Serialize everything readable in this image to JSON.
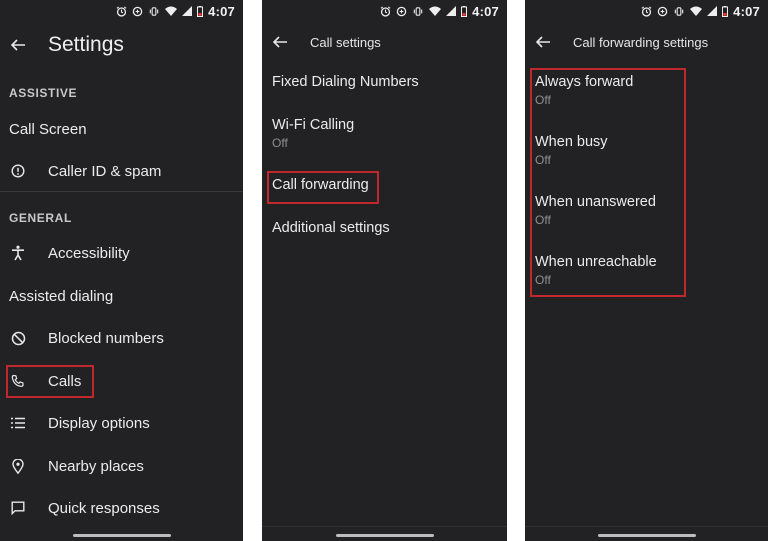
{
  "status": {
    "time": "4:07"
  },
  "panel1": {
    "title": "Settings",
    "assistive_header": "ASSISTIVE",
    "call_screen": "Call Screen",
    "caller_id": "Caller ID & spam",
    "general_header": "GENERAL",
    "accessibility": "Accessibility",
    "assisted_dialing": "Assisted dialing",
    "blocked_numbers": "Blocked numbers",
    "calls": "Calls",
    "display_options": "Display options",
    "nearby_places": "Nearby places",
    "quick_responses": "Quick responses"
  },
  "panel2": {
    "title": "Call settings",
    "items": [
      {
        "label": "Fixed Dialing Numbers",
        "sub": ""
      },
      {
        "label": "Wi-Fi Calling",
        "sub": "Off"
      },
      {
        "label": "Call forwarding",
        "sub": ""
      },
      {
        "label": "Additional settings",
        "sub": ""
      }
    ]
  },
  "panel3": {
    "title": "Call forwarding settings",
    "items": [
      {
        "label": "Always forward",
        "sub": "Off"
      },
      {
        "label": "When busy",
        "sub": "Off"
      },
      {
        "label": "When unanswered",
        "sub": "Off"
      },
      {
        "label": "When unreachable",
        "sub": "Off"
      }
    ]
  },
  "colors": {
    "background": "#222224",
    "highlight": "#c0282d",
    "text": "#ececec",
    "subtext": "#8f8f8f"
  },
  "icons": [
    "back-arrow-icon",
    "alarm-icon",
    "sync-icon",
    "vibrate-icon",
    "wifi-icon",
    "signal-icon",
    "battery-icon",
    "info-icon",
    "accessibility-icon",
    "block-icon",
    "phone-icon",
    "list-icon",
    "location-pin-icon",
    "message-icon"
  ]
}
